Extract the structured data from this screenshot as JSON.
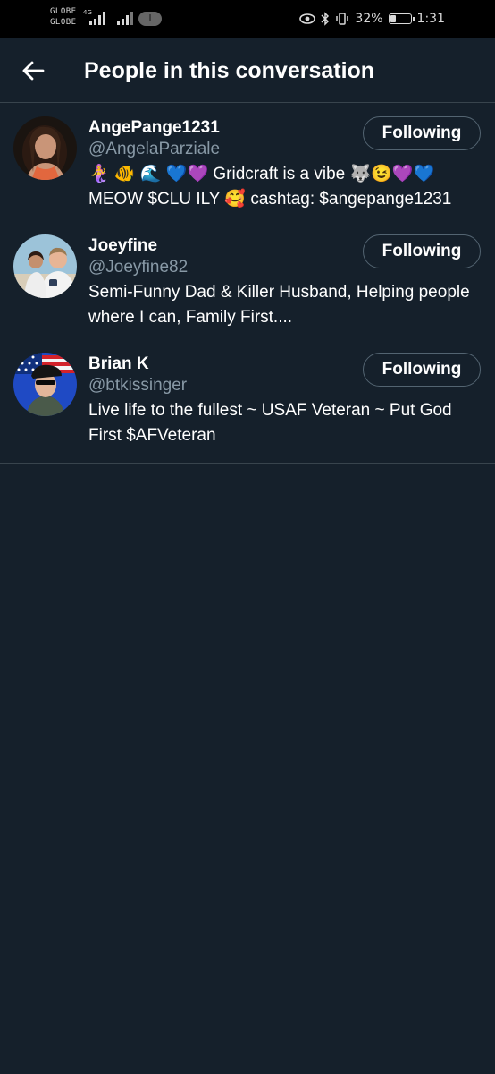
{
  "status_bar": {
    "carrier_1": "GLOBE",
    "carrier_2": "GLOBE",
    "network": "4G",
    "data_indicator": "I",
    "battery": "32%",
    "battery_level": 0.32,
    "time": "1:31"
  },
  "header": {
    "title": "People in this conversation"
  },
  "people": [
    {
      "name": "AngePange1231",
      "handle": "@AngelaParziale",
      "bio": "🧜‍♀️ 🐠 🌊 💙💜 Gridcraft is a vibe 🐺😉💜💙 MEOW $CLU ILY 🥰 cashtag: $angepange1231",
      "button": "Following"
    },
    {
      "name": "Joeyfine",
      "handle": "@Joeyfine82",
      "bio": "Semi-Funny Dad & Killer Husband, Helping people where I can, Family First....",
      "button": "Following"
    },
    {
      "name": "Brian K",
      "handle": "@btkissinger",
      "bio": "Live life to the fullest ~ USAF Veteran ~ Put God First  $AFVeteran",
      "button": "Following"
    }
  ]
}
